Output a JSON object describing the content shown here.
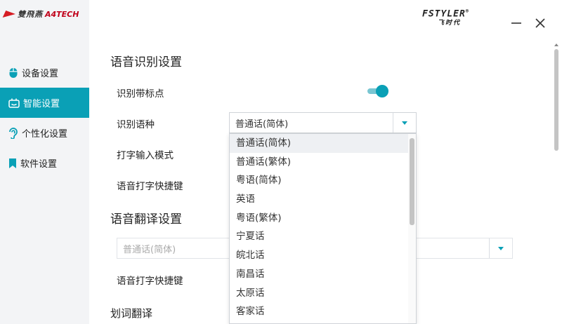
{
  "logo": {
    "brand_cn": "雙飛燕",
    "brand_en": "A4TECH"
  },
  "header": {
    "brand_top": "FSTYLER",
    "brand_reg": "®",
    "brand_sub": "飞时代"
  },
  "sidebar": {
    "items": [
      {
        "label": "设备设置",
        "icon": "mouse-icon",
        "active": false
      },
      {
        "label": "智能设置",
        "icon": "robot-icon",
        "active": true
      },
      {
        "label": "个性化设置",
        "icon": "hearing-icon",
        "active": false
      },
      {
        "label": "软件设置",
        "icon": "bookmark-icon",
        "active": false
      }
    ]
  },
  "speech_recognition": {
    "title": "语音识别设置",
    "punctuation_label": "识别带标点",
    "punctuation_on": true,
    "language_label": "识别语种",
    "language_value": "普通话(简体)",
    "typing_mode_label": "打字输入模式",
    "shortcut_label": "语音打字快捷键"
  },
  "dropdown": {
    "options": [
      "普通话(简体)",
      "普通话(繁体)",
      "粤语(简体)",
      "英语",
      "粤语(繁体)",
      "宁夏话",
      "皖北话",
      "南昌话",
      "太原话",
      "客家话"
    ],
    "selected_index": 0
  },
  "speech_translation": {
    "title": "语音翻译设置",
    "source_value": "普通话(简体)",
    "shortcut_label": "语音打字快捷键",
    "partial_label": "划词翻译"
  },
  "colors": {
    "accent": "#0aa0b6",
    "sidebar_bg": "#f3f4f6"
  }
}
